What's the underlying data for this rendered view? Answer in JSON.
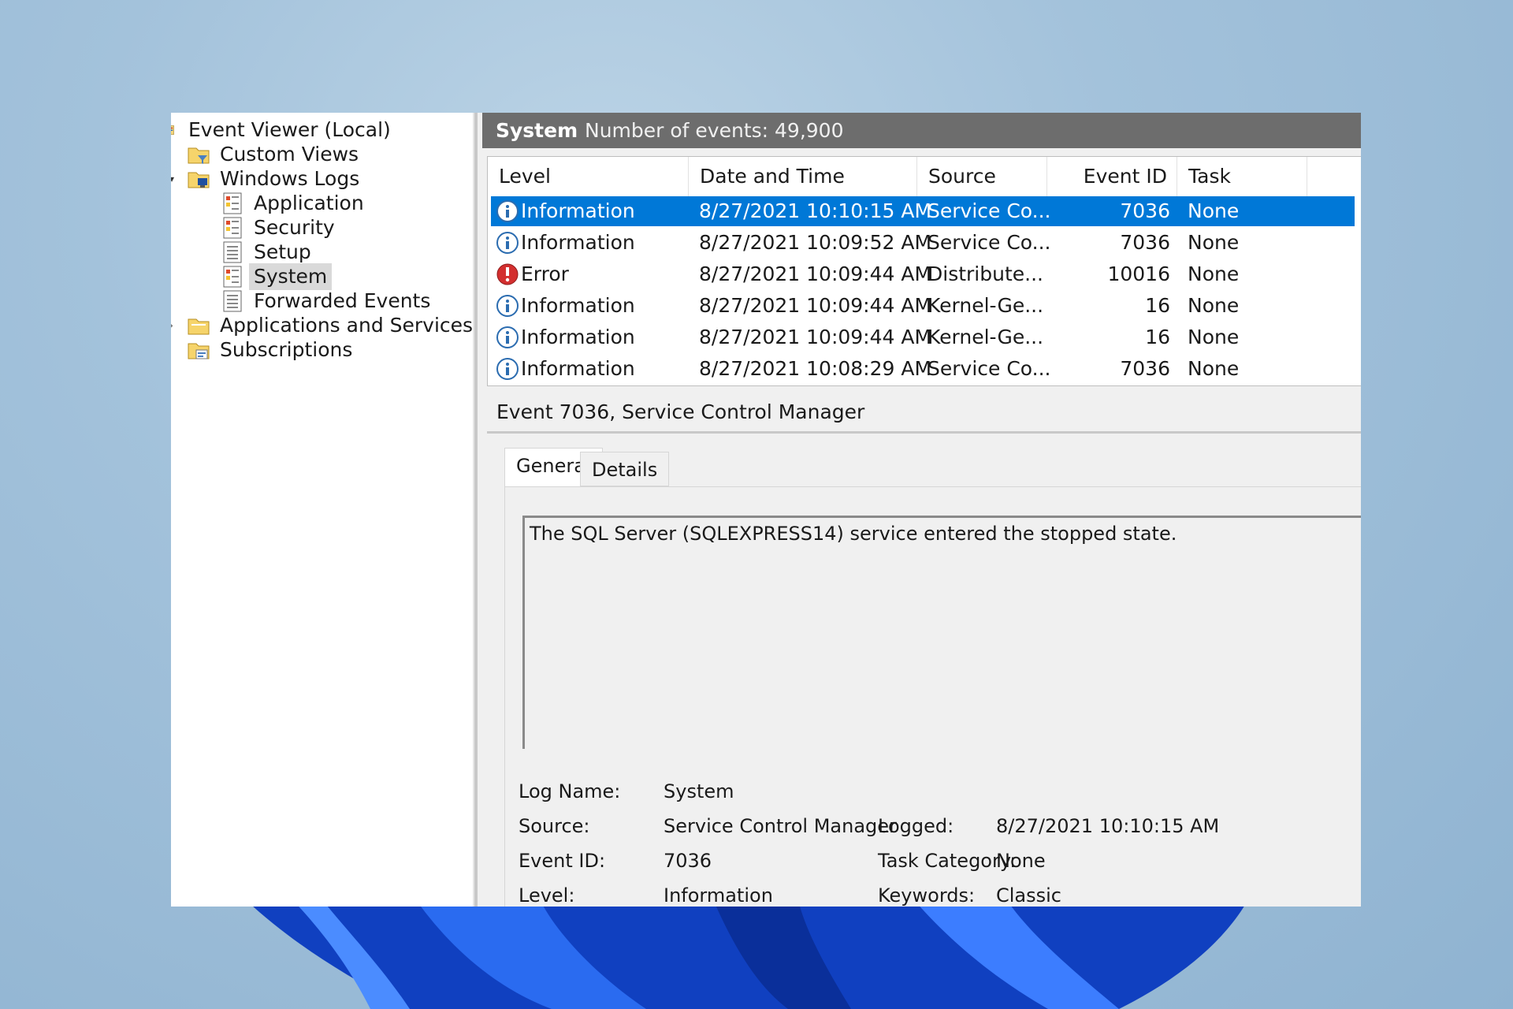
{
  "tree": {
    "root_label": "Event Viewer (Local)",
    "items": [
      {
        "label": "Custom Views",
        "icon": "folder-filter-icon"
      },
      {
        "label": "Windows Logs",
        "icon": "folder-computer-icon"
      },
      {
        "label": "Application",
        "icon": "log-icon"
      },
      {
        "label": "Security",
        "icon": "log-icon"
      },
      {
        "label": "Setup",
        "icon": "log-icon"
      },
      {
        "label": "System",
        "icon": "log-icon"
      },
      {
        "label": "Forwarded Events",
        "icon": "log-icon"
      },
      {
        "label": "Applications and Services Lo",
        "icon": "folder-icon"
      },
      {
        "label": "Subscriptions",
        "icon": "subscriptions-icon"
      }
    ]
  },
  "header": {
    "title": "System",
    "count": "Number of events: 49,900"
  },
  "grid": {
    "columns": [
      "Level",
      "Date and Time",
      "Source",
      "Event ID",
      "Task Categ..."
    ],
    "rows": [
      {
        "level": "Information",
        "date": "8/27/2021 10:10:15 AM",
        "source": "Service Co...",
        "event_id": "7036",
        "task": "None",
        "icon": "info-icon"
      },
      {
        "level": "Information",
        "date": "8/27/2021 10:09:52 AM",
        "source": "Service Co...",
        "event_id": "7036",
        "task": "None",
        "icon": "info-icon"
      },
      {
        "level": "Error",
        "date": "8/27/2021 10:09:44 AM",
        "source": "Distribute...",
        "event_id": "10016",
        "task": "None",
        "icon": "error-icon"
      },
      {
        "level": "Information",
        "date": "8/27/2021 10:09:44 AM",
        "source": "Kernel-Ge...",
        "event_id": "16",
        "task": "None",
        "icon": "info-icon"
      },
      {
        "level": "Information",
        "date": "8/27/2021 10:09:44 AM",
        "source": "Kernel-Ge...",
        "event_id": "16",
        "task": "None",
        "icon": "info-icon"
      },
      {
        "level": "Information",
        "date": "8/27/2021 10:08:29 AM",
        "source": "Service Co...",
        "event_id": "7036",
        "task": "None",
        "icon": "info-icon"
      }
    ]
  },
  "detail": {
    "title": "Event 7036, Service Control Manager",
    "tabs": [
      "General",
      "Details"
    ],
    "message": "The SQL Server (SQLEXPRESS14) service entered the stopped state.",
    "props": {
      "log_name_label": "Log Name:",
      "log_name": "System",
      "source_label": "Source:",
      "source": "Service Control Manager",
      "logged_label": "Logged:",
      "logged": "8/27/2021 10:10:15 AM",
      "event_id_label": "Event ID:",
      "event_id": "7036",
      "task_category_label": "Task Category:",
      "task_category": "None",
      "level_label": "Level:",
      "level": "Information",
      "keywords_label": "Keywords:",
      "keywords": "Classic"
    }
  },
  "colors": {
    "selection": "#0078d7",
    "header_bar": "#6d6d6d",
    "error_red": "#d32f2f",
    "info_blue": "#2b6cb0"
  }
}
